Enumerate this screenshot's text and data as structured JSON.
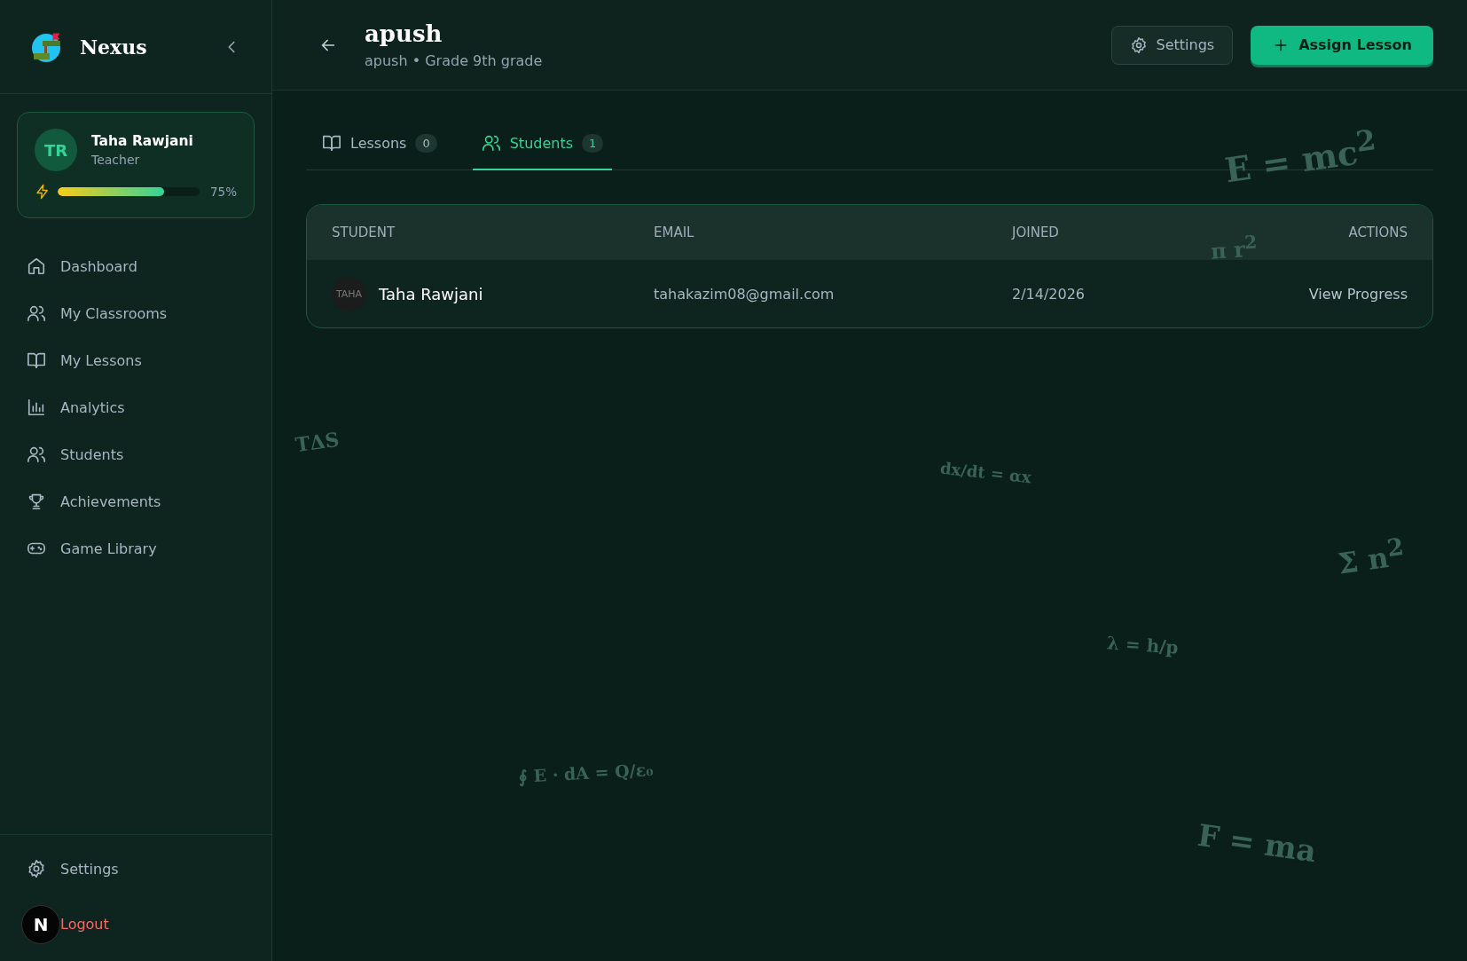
{
  "sidebar": {
    "brand": "Nexus",
    "profile": {
      "initials": "TR",
      "name": "Taha Rawjani",
      "role": "Teacher",
      "level": 0.75,
      "reading": "75%"
    },
    "nav": [
      {
        "label": "Dashboard",
        "selected": false
      },
      {
        "label": "My Classrooms",
        "selected": false
      },
      {
        "label": "My Lessons",
        "selected": false
      },
      {
        "label": "Analytics",
        "selected": false
      },
      {
        "label": "Students",
        "selected": false
      },
      {
        "label": "Achievements",
        "selected": false
      },
      {
        "label": "Game Library",
        "selected": false
      }
    ],
    "footer": [
      {
        "label": "Settings",
        "kind": "settings"
      },
      {
        "label": "Logout",
        "kind": "logout"
      }
    ]
  },
  "dev_badge": {
    "label": "N"
  },
  "header": {
    "title": "apush",
    "subtitle": "apush • Grade 9th grade",
    "buttons": [
      {
        "label": "Settings",
        "kind": "secondary"
      },
      {
        "label": "Assign Lesson",
        "kind": "primary"
      }
    ]
  },
  "tabs": [
    {
      "label": "Lessons",
      "count": "0",
      "selected": false
    },
    {
      "label": "Students",
      "count": "1",
      "selected": true
    }
  ],
  "table": {
    "columns": [
      "STUDENT",
      "EMAIL",
      "JOINED",
      "ACTIONS"
    ],
    "rows": [
      {
        "avatar": "TAHA",
        "name": "Taha Rawjani",
        "email": "tahakazim08@gmail.com",
        "joined": "2/14/2026",
        "action": "View Progress"
      }
    ]
  },
  "background_formulas": [
    "E = mc$^{2}$",
    "π r$^{2}$",
    "TΔS",
    "dx/dt = αx",
    "Σ n$^{2}$",
    "λ = h/p",
    "∮ E · dA = Q/ε₀",
    "F = ma"
  ]
}
